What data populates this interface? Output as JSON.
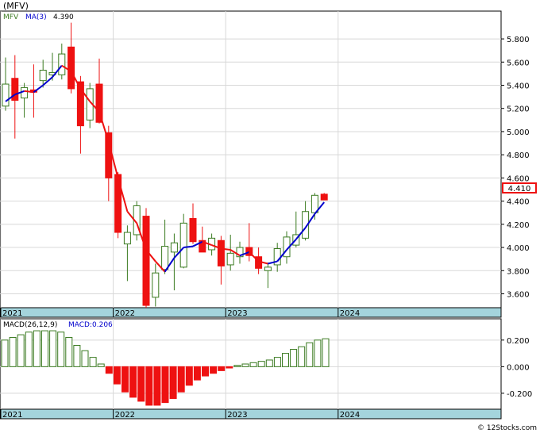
{
  "header": {
    "ticker": "(MFV)"
  },
  "watermark": "© 12Stocks.com",
  "colors": {
    "up": "#3a7a20",
    "down": "#ee1111",
    "ma": "#0000cc",
    "ma_down": "#ee1111",
    "axis_band": "#a4d4dc"
  },
  "chart_data": [
    {
      "type": "candlestick",
      "title": "",
      "legend": [
        {
          "label": "MFV",
          "color": "#3a7a20"
        },
        {
          "label": "MA(3)",
          "color": "#0000cc"
        },
        {
          "label": "4.390",
          "color": "#000000"
        }
      ],
      "last_price": "4.410",
      "ylim": [
        3.48,
        6.04
      ],
      "yticks": [
        "5.800",
        "5.600",
        "5.400",
        "5.200",
        "5.000",
        "4.800",
        "4.600",
        "4.400",
        "4.200",
        "4.000",
        "3.800",
        "3.600"
      ],
      "xticks": [
        {
          "label": "2021",
          "index": 0
        },
        {
          "label": "2022",
          "index": 12
        },
        {
          "label": "2023",
          "index": 24
        },
        {
          "label": "2024",
          "index": 36
        }
      ],
      "candles": [
        {
          "o": 5.22,
          "h": 5.64,
          "l": 5.18,
          "c": 5.41
        },
        {
          "o": 5.46,
          "h": 5.66,
          "l": 4.94,
          "c": 5.27
        },
        {
          "o": 5.29,
          "h": 5.42,
          "l": 5.12,
          "c": 5.38
        },
        {
          "o": 5.36,
          "h": 5.58,
          "l": 5.12,
          "c": 5.34
        },
        {
          "o": 5.44,
          "h": 5.62,
          "l": 5.38,
          "c": 5.53
        },
        {
          "o": 5.49,
          "h": 5.68,
          "l": 5.44,
          "c": 5.51
        },
        {
          "o": 5.49,
          "h": 5.76,
          "l": 5.45,
          "c": 5.67
        },
        {
          "o": 5.73,
          "h": 5.94,
          "l": 5.33,
          "c": 5.37
        },
        {
          "o": 5.43,
          "h": 5.48,
          "l": 4.81,
          "c": 5.05
        },
        {
          "o": 5.1,
          "h": 5.42,
          "l": 5.03,
          "c": 5.37
        },
        {
          "o": 5.41,
          "h": 5.63,
          "l": 5.07,
          "c": 5.08
        },
        {
          "o": 4.99,
          "h": 5.05,
          "l": 4.4,
          "c": 4.6
        },
        {
          "o": 4.63,
          "h": 4.65,
          "l": 4.08,
          "c": 4.13
        },
        {
          "o": 4.03,
          "h": 4.19,
          "l": 3.71,
          "c": 4.13
        },
        {
          "o": 4.11,
          "h": 4.4,
          "l": 4.06,
          "c": 4.36
        },
        {
          "o": 4.27,
          "h": 4.34,
          "l": 3.48,
          "c": 3.5
        },
        {
          "o": 3.57,
          "h": 3.86,
          "l": 3.49,
          "c": 3.78
        },
        {
          "o": 3.81,
          "h": 4.24,
          "l": 3.77,
          "c": 4.01
        },
        {
          "o": 3.96,
          "h": 4.12,
          "l": 3.63,
          "c": 4.04
        },
        {
          "o": 3.83,
          "h": 4.29,
          "l": 3.82,
          "c": 4.21
        },
        {
          "o": 4.25,
          "h": 4.38,
          "l": 4.03,
          "c": 4.05
        },
        {
          "o": 4.06,
          "h": 4.18,
          "l": 3.98,
          "c": 3.96
        },
        {
          "o": 3.98,
          "h": 4.12,
          "l": 3.93,
          "c": 4.08
        },
        {
          "o": 4.06,
          "h": 4.1,
          "l": 3.68,
          "c": 3.84
        },
        {
          "o": 3.85,
          "h": 4.11,
          "l": 3.8,
          "c": 3.95
        },
        {
          "o": 3.92,
          "h": 4.05,
          "l": 3.86,
          "c": 4.0
        },
        {
          "o": 4.0,
          "h": 4.21,
          "l": 3.88,
          "c": 3.93
        },
        {
          "o": 3.92,
          "h": 4.0,
          "l": 3.77,
          "c": 3.82
        },
        {
          "o": 3.8,
          "h": 3.87,
          "l": 3.65,
          "c": 3.83
        },
        {
          "o": 3.85,
          "h": 4.04,
          "l": 3.79,
          "c": 3.99
        },
        {
          "o": 3.92,
          "h": 4.14,
          "l": 3.86,
          "c": 4.09
        },
        {
          "o": 4.02,
          "h": 4.31,
          "l": 4.0,
          "c": 4.11
        },
        {
          "o": 4.08,
          "h": 4.4,
          "l": 4.06,
          "c": 4.31
        },
        {
          "o": 4.3,
          "h": 4.47,
          "l": 4.24,
          "c": 4.45
        },
        {
          "o": 4.46,
          "h": 4.47,
          "l": 4.41,
          "c": 4.41
        }
      ],
      "ma": [
        5.26,
        5.32,
        5.35,
        5.34,
        5.4,
        5.47,
        5.57,
        5.52,
        5.37,
        5.26,
        5.17,
        4.91,
        4.6,
        4.31,
        4.21,
        3.98,
        3.88,
        3.79,
        3.91,
        4.0,
        4.01,
        4.05,
        4.02,
        3.99,
        3.98,
        3.93,
        3.96,
        3.88,
        3.86,
        3.88,
        3.98,
        4.07,
        4.17,
        4.29,
        4.39
      ]
    },
    {
      "type": "bar",
      "title": "",
      "legend": [
        {
          "label": "MACD(26,12,9)",
          "color": "#000000"
        },
        {
          "label": "MACD:0.206",
          "color": "#0000cc"
        }
      ],
      "ylim": [
        -0.32,
        0.36
      ],
      "yticks": [
        "0.200",
        "0.000",
        "-0.200"
      ],
      "xticks": [
        {
          "label": "2021",
          "index": 0
        },
        {
          "label": "2022",
          "index": 12
        },
        {
          "label": "2023",
          "index": 24
        },
        {
          "label": "2024",
          "index": 36
        }
      ],
      "values": [
        0.2,
        0.22,
        0.24,
        0.26,
        0.27,
        0.27,
        0.27,
        0.26,
        0.22,
        0.16,
        0.12,
        0.07,
        0.02,
        -0.05,
        -0.13,
        -0.19,
        -0.23,
        -0.26,
        -0.29,
        -0.29,
        -0.27,
        -0.24,
        -0.19,
        -0.14,
        -0.1,
        -0.07,
        -0.05,
        -0.03,
        -0.01,
        0.01,
        0.02,
        0.03,
        0.04,
        0.05,
        0.07,
        0.1,
        0.13,
        0.15,
        0.18,
        0.2,
        0.21
      ],
      "colors": {
        "up": "#3a7a20",
        "down": "#ee1111"
      }
    }
  ]
}
